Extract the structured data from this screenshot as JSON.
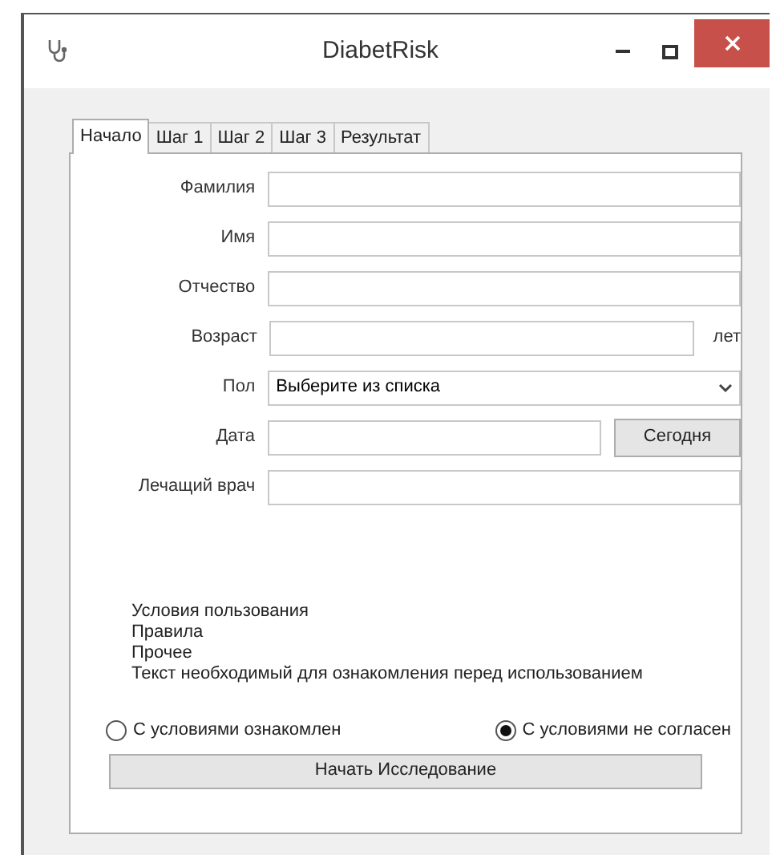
{
  "window": {
    "title": "DiabetRisk"
  },
  "tabs": [
    {
      "label": "Начало",
      "selected": true
    },
    {
      "label": "Шаг 1",
      "selected": false
    },
    {
      "label": "Шаг 2",
      "selected": false
    },
    {
      "label": "Шаг 3",
      "selected": false
    },
    {
      "label": "Результат",
      "selected": false
    }
  ],
  "fields": [
    {
      "kind": "text",
      "label": "Фамилия"
    },
    {
      "kind": "text",
      "label": "Имя"
    },
    {
      "kind": "text",
      "label": "Отчество"
    },
    {
      "kind": "suffix",
      "label": "Возраст",
      "suffix": "лет"
    },
    {
      "kind": "select",
      "label": "Пол",
      "value": "Выберите из списка"
    },
    {
      "kind": "button",
      "label": "Дата",
      "button": "Сегодня"
    },
    {
      "kind": "text",
      "label": "Лечащий врач"
    }
  ],
  "terms": [
    "Условия пользования",
    "Правила",
    "Прочее",
    "Текст необходимый для ознакомления перед использованием"
  ],
  "radios": [
    {
      "label": "С условиями ознакомлен",
      "selected": false
    },
    {
      "label": "С условиями не согласен",
      "selected": true
    }
  ],
  "start_button": "Начать Исследование"
}
